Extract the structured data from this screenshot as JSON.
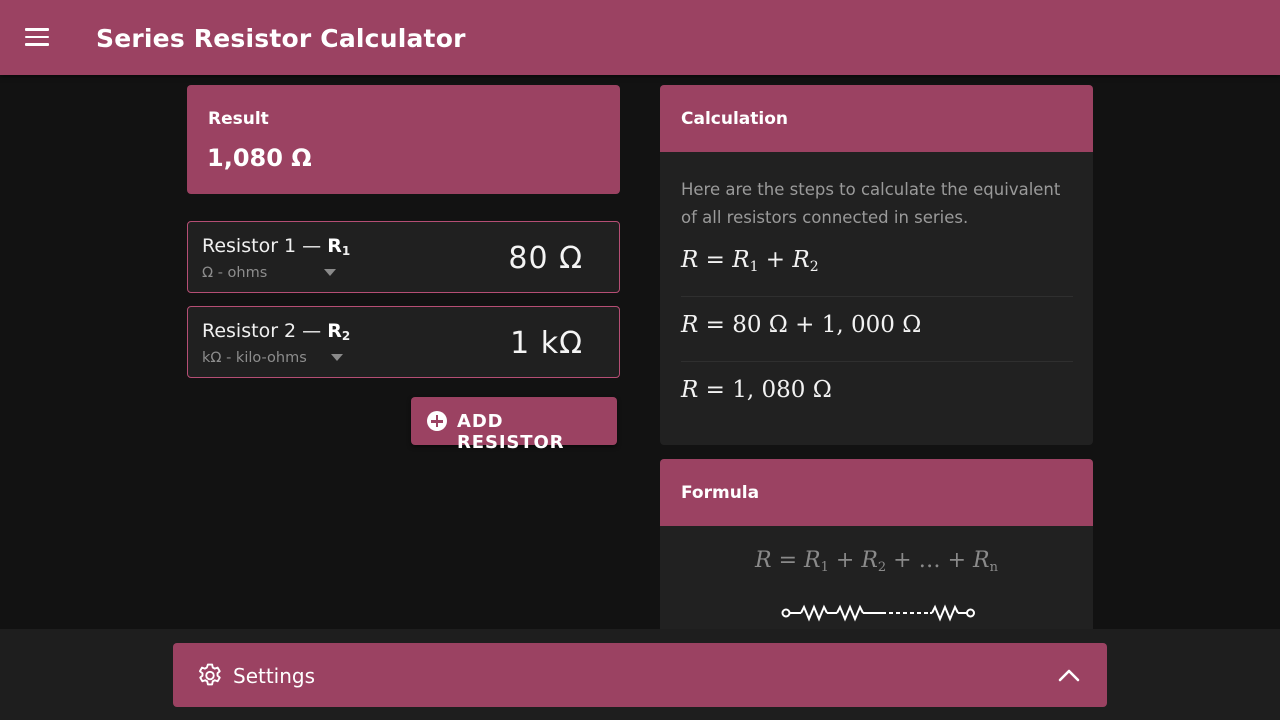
{
  "app": {
    "title": "Series Resistor Calculator"
  },
  "result": {
    "label": "Result",
    "value": "1,080 Ω"
  },
  "resistors": [
    {
      "label_prefix": "Resistor 1 —",
      "symbol": "R",
      "index": "1",
      "unit": "Ω - ohms",
      "value": "80  Ω"
    },
    {
      "label_prefix": "Resistor 2 —",
      "symbol": "R",
      "index": "2",
      "unit": "kΩ - kilo-ohms",
      "value": "1  kΩ"
    }
  ],
  "add_button": {
    "label": "ADD RESISTOR"
  },
  "calculation": {
    "title": "Calculation",
    "intro": "Here are the steps to calculate the equivalent of all resistors connected in series.",
    "steps": {
      "step1": {
        "lhs": "R",
        "eq": " = ",
        "t1": "R",
        "t1_sub": "1",
        "plus": " + ",
        "t2": "R",
        "t2_sub": "2"
      },
      "step2": {
        "lhs": "R",
        "rest": " = 80 Ω + 1, 000 Ω"
      },
      "step3": {
        "lhs": "R",
        "rest": " = 1, 080 Ω"
      }
    }
  },
  "formula": {
    "title": "Formula",
    "lhs": "R",
    "eq": " = ",
    "t1": "R",
    "t1_sub": "1",
    "plus1": " + ",
    "t2": "R",
    "t2_sub": "2",
    "plus2": " + … + ",
    "tn": "R",
    "tn_sub": "n"
  },
  "settings": {
    "label": "Settings"
  },
  "icons": {
    "menu": "menu-icon",
    "add": "add-circle-icon",
    "settings": "gear-icon",
    "expand": "chevron-up-icon",
    "dropdown": "caret-down-icon",
    "circuit": "series-resistor-circuit-icon"
  },
  "colors": {
    "primary": "#9b4262",
    "background": "#121212",
    "card": "#212121",
    "field_border": "#b54e74"
  }
}
